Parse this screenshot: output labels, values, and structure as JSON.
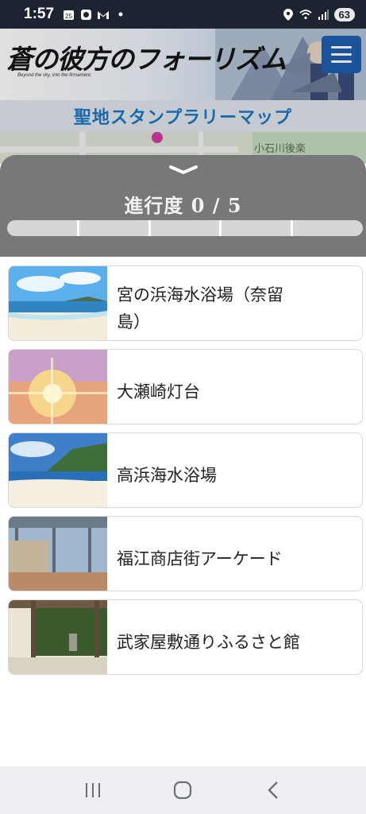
{
  "status_bar": {
    "time": "1:57",
    "calendar_badge": "25",
    "battery": "63"
  },
  "header": {
    "logo_text": "蒼の彼方のフォーリズム",
    "logo_subtitle": "Beyond the sky, into the firmament.",
    "menu_label": "menu"
  },
  "subtitle": "聖地スタンプラリーマップ",
  "map": {
    "visible_label": "小石川後楽"
  },
  "progress": {
    "label": "進行度 0 / 5",
    "completed": 0,
    "total": 5
  },
  "spots": [
    {
      "name": "宮の浜海水浴場（奈留島）",
      "thumb": "beach-sky"
    },
    {
      "name": "大瀬崎灯台",
      "thumb": "sunset-glow"
    },
    {
      "name": "高浜海水浴場",
      "thumb": "coast-hills"
    },
    {
      "name": "福江商店街アーケード",
      "thumb": "arcade-street"
    },
    {
      "name": "武家屋敷通りふるさと館",
      "thumb": "samurai-house"
    }
  ],
  "colors": {
    "accent": "#1f5fb0",
    "subtitle": "#1d79c4",
    "panel": "#777879"
  }
}
